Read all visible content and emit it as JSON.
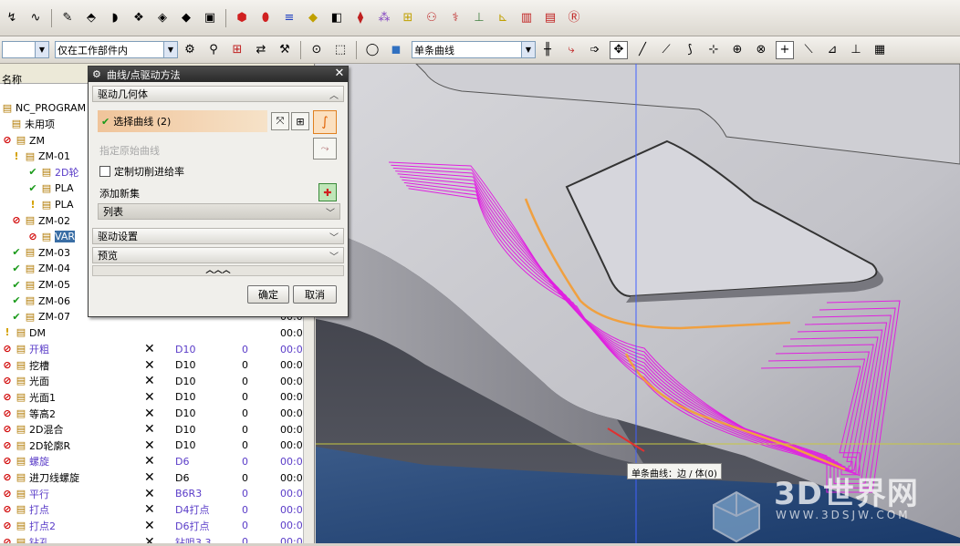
{
  "toolbar2": {
    "filter_value": "仅在工作部件内",
    "curve_rule_value": "单条曲线"
  },
  "navigator": {
    "column_name": "名称",
    "rows": [
      {
        "indent": 0,
        "name": "NC_PROGRAM",
        "tool": "",
        "num": "",
        "time": "",
        "status": "none",
        "purple": false,
        "check": false
      },
      {
        "indent": 1,
        "name": "未用项",
        "tool": "",
        "num": "",
        "time": "",
        "status": "none",
        "purple": false,
        "check": false
      },
      {
        "indent": 0,
        "name": "ZM",
        "tool": "",
        "num": "",
        "time": "",
        "status": "no",
        "purple": false,
        "check": false
      },
      {
        "indent": 1,
        "name": "ZM-01",
        "tool": "",
        "num": "",
        "time": "",
        "status": "warn",
        "purple": false,
        "check": false
      },
      {
        "indent": 2,
        "name": "2D轮",
        "tool": "",
        "num": "",
        "time": "",
        "status": "ok",
        "purple": true,
        "check": false
      },
      {
        "indent": 2,
        "name": "PLA",
        "tool": "",
        "num": "",
        "time": "",
        "status": "ok",
        "purple": false,
        "check": false
      },
      {
        "indent": 2,
        "name": "PLA",
        "tool": "",
        "num": "",
        "time": "",
        "status": "warn",
        "purple": false,
        "check": false
      },
      {
        "indent": 1,
        "name": "ZM-02",
        "tool": "",
        "num": "",
        "time": "",
        "status": "no",
        "purple": false,
        "check": false
      },
      {
        "indent": 2,
        "name": "VAR",
        "tool": "",
        "num": "",
        "time": "",
        "status": "no",
        "purple": false,
        "check": false,
        "selected": true
      },
      {
        "indent": 1,
        "name": "ZM-03",
        "tool": "",
        "num": "",
        "time": "",
        "status": "ok",
        "purple": false,
        "check": false
      },
      {
        "indent": 1,
        "name": "ZM-04",
        "tool": "",
        "num": "",
        "time": "",
        "status": "ok",
        "purple": false,
        "check": false
      },
      {
        "indent": 1,
        "name": "ZM-05",
        "tool": "",
        "num": "",
        "time": "",
        "status": "ok",
        "purple": false,
        "check": false
      },
      {
        "indent": 1,
        "name": "ZM-06",
        "tool": "",
        "num": "",
        "time": "",
        "status": "ok",
        "purple": false,
        "check": false
      },
      {
        "indent": 1,
        "name": "ZM-07",
        "tool": "",
        "num": "",
        "time": "00:0",
        "status": "ok",
        "purple": false,
        "check": false
      },
      {
        "indent": 0,
        "name": "DM",
        "tool": "",
        "num": "",
        "time": "00:0",
        "status": "warn",
        "purple": false,
        "check": false
      },
      {
        "indent": 0,
        "name": "开粗",
        "tool": "D10",
        "num": "0",
        "time": "00:0",
        "status": "no",
        "purple": true,
        "check": true
      },
      {
        "indent": 0,
        "name": "挖槽",
        "tool": "D10",
        "num": "0",
        "time": "00:0",
        "status": "no",
        "purple": false,
        "check": true
      },
      {
        "indent": 0,
        "name": "光面",
        "tool": "D10",
        "num": "0",
        "time": "00:0",
        "status": "no",
        "purple": false,
        "check": true
      },
      {
        "indent": 0,
        "name": "光面1",
        "tool": "D10",
        "num": "0",
        "time": "00:0",
        "status": "no",
        "purple": false,
        "check": true
      },
      {
        "indent": 0,
        "name": "等高2",
        "tool": "D10",
        "num": "0",
        "time": "00:0",
        "status": "no",
        "purple": false,
        "check": true
      },
      {
        "indent": 0,
        "name": "2D混合",
        "tool": "D10",
        "num": "0",
        "time": "00:0",
        "status": "no",
        "purple": false,
        "check": true
      },
      {
        "indent": 0,
        "name": "2D轮廓R",
        "tool": "D10",
        "num": "0",
        "time": "00:0",
        "status": "no",
        "purple": false,
        "check": true
      },
      {
        "indent": 0,
        "name": "螺旋",
        "tool": "D6",
        "num": "0",
        "time": "00:0",
        "status": "no",
        "purple": true,
        "check": true
      },
      {
        "indent": 0,
        "name": "进刀线螺旋",
        "tool": "D6",
        "num": "0",
        "time": "00:0",
        "status": "no",
        "purple": false,
        "check": true
      },
      {
        "indent": 0,
        "name": "平行",
        "tool": "B6R3",
        "num": "0",
        "time": "00:0",
        "status": "no",
        "purple": true,
        "check": true
      },
      {
        "indent": 0,
        "name": "打点",
        "tool": "D4打点",
        "num": "0",
        "time": "00:0",
        "status": "no",
        "purple": true,
        "check": true
      },
      {
        "indent": 0,
        "name": "打点2",
        "tool": "D6打点",
        "num": "0",
        "time": "00:0",
        "status": "no",
        "purple": true,
        "check": true
      },
      {
        "indent": 0,
        "name": "钻孔",
        "tool": "钻咀3.3",
        "num": "0",
        "time": "00:0",
        "status": "no",
        "purple": true,
        "check": true
      }
    ]
  },
  "dialog": {
    "title": "曲线/点驱动方法",
    "section_geometry": "驱动几何体",
    "select_curve": "选择曲线 (2)",
    "start_curve": "指定原始曲线",
    "custom_feed": "定制切削进给率",
    "add_set": "添加新集",
    "list": "列表",
    "section_drive": "驱动设置",
    "section_preview": "预览",
    "ok": "确定",
    "cancel": "取消"
  },
  "viewport": {
    "tooltip": "单条曲线：边 / 体(0)",
    "watermark_title": "3D世界网",
    "watermark_url": "WWW.3DSJW.COM",
    "colors": {
      "toolpath": "#e020e0",
      "drive_curve": "#f0a040",
      "crosshair_v": "#4060ff",
      "crosshair_h": "#c8c840"
    }
  }
}
